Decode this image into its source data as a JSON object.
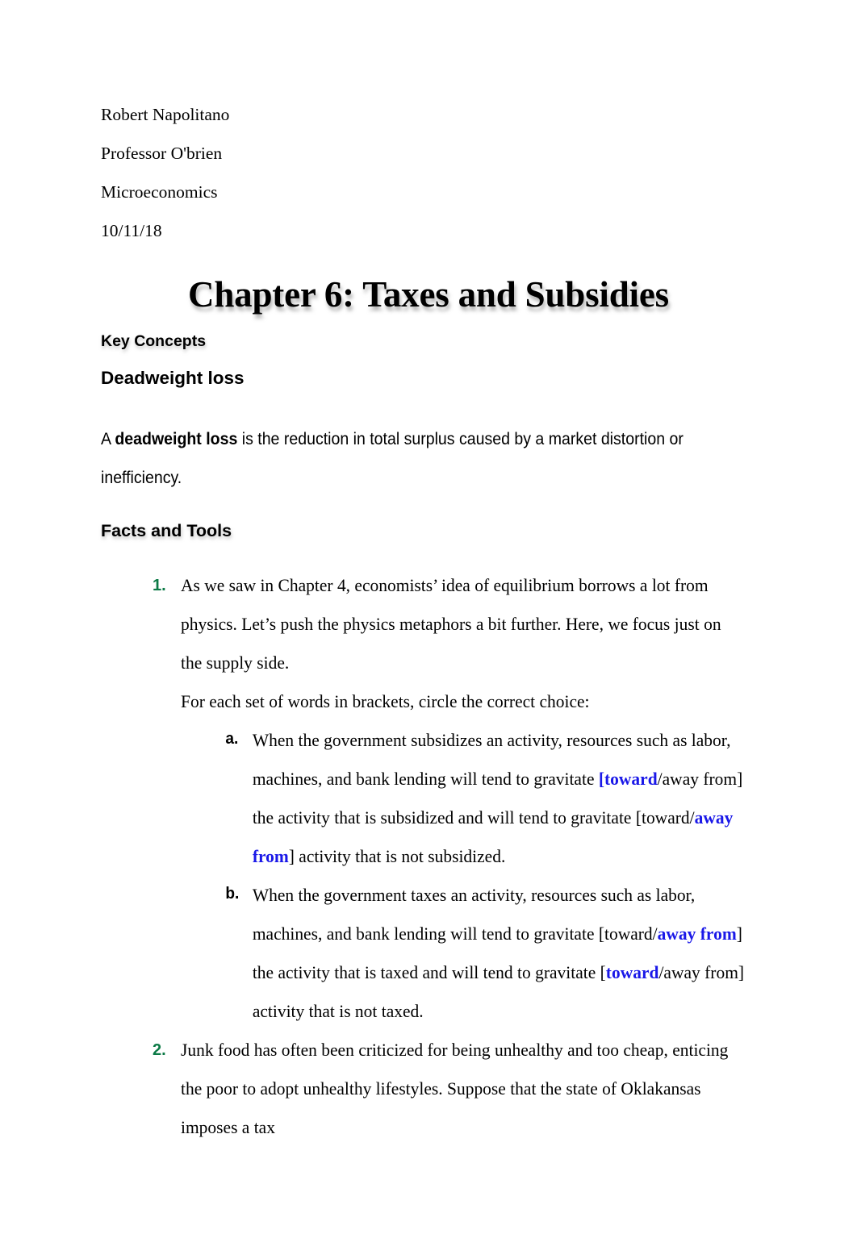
{
  "document": {
    "header_lines": [
      "Robert Napolitano",
      "Professor O'brien",
      "Microeconomics",
      "10/11/18"
    ],
    "title": "Chapter 6: Taxes and Subsidies",
    "sections": {
      "key_concepts_heading": "Key Concepts",
      "deadweight_heading": "Deadweight loss",
      "deadweight_def_pre": "A ",
      "deadweight_def_bold": "deadweight loss",
      "deadweight_def_post": " is the reduction in total surplus caused by a market distortion or inefficiency.",
      "facts_and_tools_heading": "Facts and Tools"
    },
    "list": {
      "item1": {
        "marker": "1.",
        "paragraph1": "As we saw in Chapter 4, economists’ idea of equilibrium borrows a lot from physics. Let’s push the physics metaphors a bit further. Here, we focus just on the supply side.",
        "paragraph2": "For each set of words in brackets, circle the correct choice:",
        "sub_a": {
          "marker": "a.",
          "seg1": "When the government subsidizes an activity, resources such as labor, machines, and bank lending will tend to gravitate ",
          "pick1": "[toward",
          "seg2": "/away from] the activity that is subsidized and will tend to gravitate [toward/",
          "pick2": "away from",
          "seg3": "] activity that is not subsidized."
        },
        "sub_b": {
          "marker": "b.",
          "seg1": "When the government taxes an activity, resources such as labor, machines, and bank lending will tend to gravitate [toward/",
          "pick1": "away from",
          "seg2": "] the activity that is taxed and will tend to gravitate [",
          "pick2": "toward",
          "seg3": "/away from] activity that is not taxed."
        }
      },
      "item2": {
        "marker": "2.",
        "paragraph1": "Junk food has often been criticized for being unhealthy and too cheap, enticing the poor to adopt unhealthy lifestyles. Suppose that the state of Oklakansas imposes a tax"
      }
    },
    "colors": {
      "marker_green": "#0C7A46",
      "answer_blue": "#1A18E8",
      "text_black": "#000000",
      "page_background": "#FFFFFF"
    }
  }
}
